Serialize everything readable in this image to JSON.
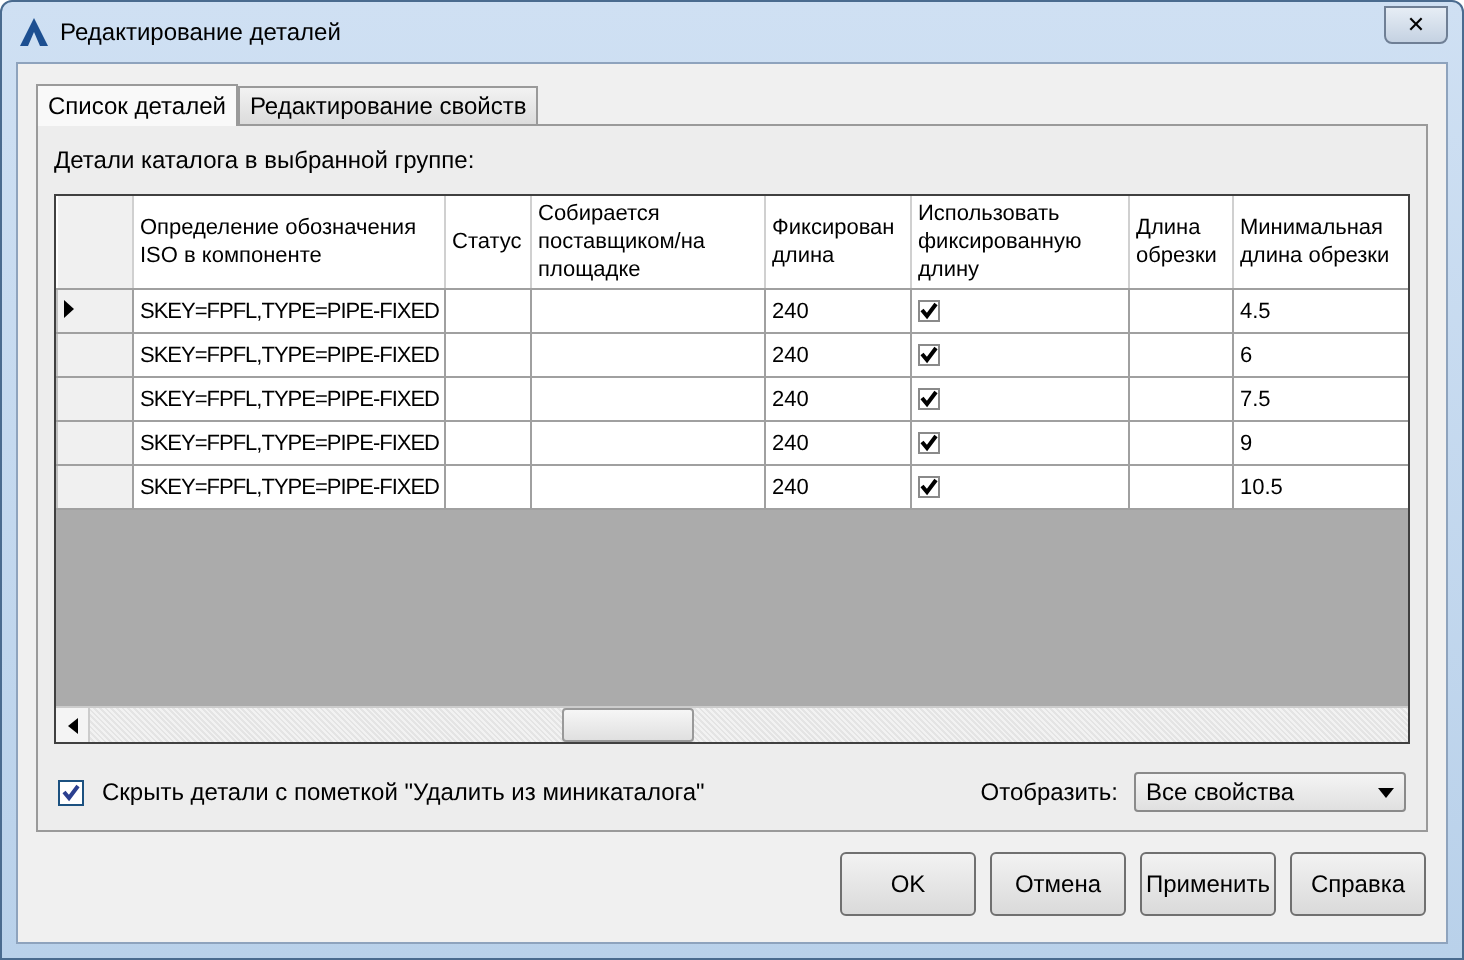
{
  "window": {
    "title": "Редактирование деталей",
    "close": "✕"
  },
  "tabs": [
    {
      "label": "Список деталей",
      "selected": true
    },
    {
      "label": "Редактирование свойств",
      "selected": false
    }
  ],
  "grid_caption": "Детали каталога в выбранной группе:",
  "table": {
    "columns": [
      "Определение обозначения ISO в компоненте",
      "Статус",
      "Собирается поставщиком/на площадке",
      "Фиксирован длина",
      "Использовать фиксированную длину",
      "Длина обрезки",
      "Минимальная длина обрезки"
    ],
    "rows": [
      {
        "current": true,
        "definition": "SKEY=FPFL,TYPE=PIPE-FIXED",
        "fixed_length": "240",
        "use_fixed": true,
        "min_cut": "4.5"
      },
      {
        "current": false,
        "definition": "SKEY=FPFL,TYPE=PIPE-FIXED",
        "fixed_length": "240",
        "use_fixed": true,
        "min_cut": "6"
      },
      {
        "current": false,
        "definition": "SKEY=FPFL,TYPE=PIPE-FIXED",
        "fixed_length": "240",
        "use_fixed": true,
        "min_cut": "7.5"
      },
      {
        "current": false,
        "definition": "SKEY=FPFL,TYPE=PIPE-FIXED",
        "fixed_length": "240",
        "use_fixed": true,
        "min_cut": "9"
      },
      {
        "current": false,
        "definition": "SKEY=FPFL,TYPE=PIPE-FIXED",
        "fixed_length": "240",
        "use_fixed": true,
        "min_cut": "10.5"
      }
    ]
  },
  "hide_option": {
    "label": "Скрыть детали с пометкой \"Удалить из миникаталога\"",
    "checked": true
  },
  "display": {
    "label": "Отобразить:",
    "value": "Все свойства"
  },
  "buttons": [
    "OK",
    "Отмена",
    "Применить",
    "Справка"
  ]
}
